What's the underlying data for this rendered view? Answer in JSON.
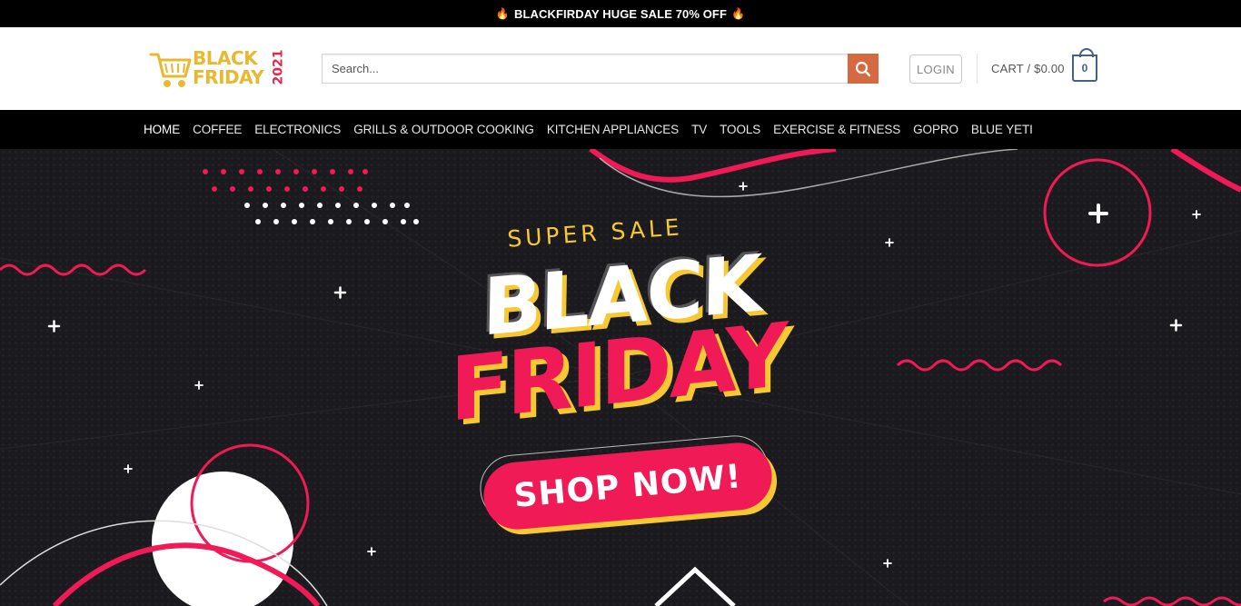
{
  "announcement": {
    "text": "BLACKFIRDAY HUGE SALE 70% OFF",
    "icon_left": "fire-icon",
    "icon_right": "fire-icon"
  },
  "logo": {
    "line1": "BLACK",
    "line2": "FRIDAY",
    "year": "2021"
  },
  "search": {
    "placeholder": "Search...",
    "value": ""
  },
  "header": {
    "login_label": "LOGIN",
    "cart_label": "CART / $0.00",
    "cart_count": "0"
  },
  "nav": {
    "items": [
      {
        "label": "HOME",
        "active": true
      },
      {
        "label": "COFFEE"
      },
      {
        "label": "ELECTRONICS"
      },
      {
        "label": "GRILLS & OUTDOOR COOKING"
      },
      {
        "label": "KITCHEN APPLIANCES"
      },
      {
        "label": "TV"
      },
      {
        "label": "TOOLS"
      },
      {
        "label": "EXERCISE & FITNESS"
      },
      {
        "label": "GOPRO"
      },
      {
        "label": "BLUE YETI"
      }
    ]
  },
  "hero": {
    "super_sale": "SUPER SALE",
    "black": "BLACK",
    "friday": "FRIDAY",
    "cta": "SHOP NOW!"
  },
  "colors": {
    "announcement_bg": "#000000",
    "nav_bg": "#000000",
    "search_button": "#d56a42",
    "cart_accent": "#446084",
    "hero_bg": "#1b1a1e",
    "hero_pink": "#f01a57",
    "hero_yellow": "#f6c933"
  }
}
